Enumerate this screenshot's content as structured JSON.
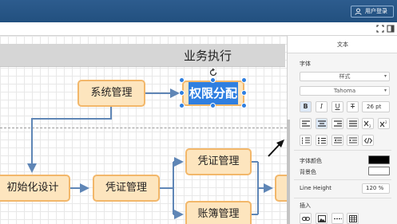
{
  "topbar": {
    "login_label": "用户登录"
  },
  "canvas": {
    "lane_title": "业务执行",
    "nodes": {
      "system_mgmt": "系统管理",
      "permission": "权限分配",
      "init_design": "初始化设计",
      "voucher_mgmt_1": "凭证管理",
      "voucher_mgmt_2": "凭证管理",
      "ledger_mgmt": "账簿管理"
    }
  },
  "panel": {
    "tab": "文本",
    "font_label": "字体",
    "style_select": "样式",
    "font_select": "Tahoma",
    "bold": "B",
    "italic": "I",
    "underline": "U",
    "clear_format": "T",
    "font_size": "26 pt",
    "font_color_label": "字体颜色",
    "bg_color_label": "背景色",
    "font_color": "#000000",
    "bg_color": "#ffffff",
    "line_height_label": "Line Height",
    "line_height": "120 %",
    "insert_label": "插入",
    "accent": "#2f7fe0"
  }
}
